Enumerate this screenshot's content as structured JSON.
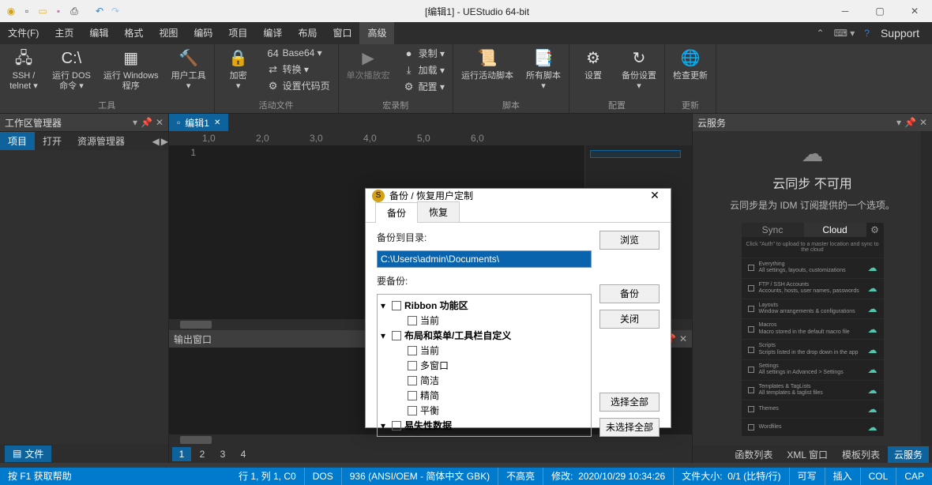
{
  "title": "[编辑1] - UEStudio 64-bit",
  "menubar": [
    "文件(F)",
    "主页",
    "编辑",
    "格式",
    "视图",
    "编码",
    "项目",
    "编译",
    "布局",
    "窗口",
    "高级"
  ],
  "menubar_active_index": 10,
  "menubar_right": {
    "support": "Support"
  },
  "ribbon": {
    "groups": [
      {
        "label": "工具",
        "buttons": [
          {
            "name": "ssh-telnet",
            "label": "SSH /\ntelnet ▾"
          },
          {
            "name": "run-dos",
            "label": "运行 DOS\n命令 ▾"
          },
          {
            "name": "run-windows",
            "label": "运行 Windows\n程序"
          },
          {
            "name": "user-tools",
            "label": "用户工具\n▾"
          }
        ]
      },
      {
        "label": "活动文件",
        "buttons": [
          {
            "name": "encrypt",
            "label": "加密\n▾"
          }
        ],
        "small": [
          {
            "name": "base64",
            "label": "Base64 ▾"
          },
          {
            "name": "convert",
            "label": "转换 ▾"
          },
          {
            "name": "set-codepage",
            "label": "设置代码页"
          }
        ]
      },
      {
        "label": "宏录制",
        "buttons": [
          {
            "name": "playback-once",
            "label": "单次播放宏",
            "disabled": true
          }
        ],
        "small": [
          {
            "name": "record",
            "label": "录制 ▾"
          },
          {
            "name": "load",
            "label": "加载 ▾"
          },
          {
            "name": "configure-macro",
            "label": "配置 ▾"
          }
        ]
      },
      {
        "label": "脚本",
        "buttons": [
          {
            "name": "run-active-script",
            "label": "运行活动脚本"
          },
          {
            "name": "all-scripts",
            "label": "所有脚本\n▾"
          }
        ]
      },
      {
        "label": "配置",
        "buttons": [
          {
            "name": "settings",
            "label": "设置"
          },
          {
            "name": "backup-settings",
            "label": "备份设置\n▾"
          }
        ]
      },
      {
        "label": "更新",
        "buttons": [
          {
            "name": "check-update",
            "label": "检查更新"
          }
        ]
      }
    ]
  },
  "left_panel": {
    "title": "工作区管理器",
    "tabs": [
      "项目",
      "打开",
      "资源管理器"
    ],
    "active_tab": 0,
    "bottom_tab": {
      "icon": "file-icon",
      "label": "文件"
    }
  },
  "editor": {
    "tab_label": "编辑1",
    "ruler_marks": [
      "1,0",
      "2,0",
      "3,0",
      "4,0",
      "5,0",
      "6,0"
    ],
    "line_number": "1"
  },
  "output": {
    "title": "输出窗口",
    "tabs": [
      "1",
      "2",
      "3",
      "4"
    ],
    "active_tab": 0
  },
  "right_panel": {
    "title": "云服务",
    "heading": "云同步 不可用",
    "sub": "云同步是为 IDM 订阅提供的一个选项。",
    "cp_tabs": [
      "Sync",
      "Cloud"
    ],
    "cp_msg": "Click \"Auth\" to upload to a master location and sync to the cloud",
    "cp_rows": [
      "Everything\nAll settings, layouts, customizations",
      "FTP / SSH Accounts\nAccounts, hosts, user names, passwords",
      "Layouts\nWindow arrangements & configurations",
      "Macros\nMacro stored in the default macro file",
      "Scripts\nScripts listed in the drop down in the app",
      "Settings\nAll settings in Advanced > Settings",
      "Templates & TagLists\nAll templates & taglist files",
      "Themes",
      "Wordfiles"
    ],
    "bottom_tabs": [
      "函数列表",
      "XML 窗口",
      "模板列表",
      "云服务"
    ],
    "bottom_active": 3
  },
  "dialog": {
    "title": "备份 / 恢复用户定制",
    "tabs": [
      "备份",
      "恢复"
    ],
    "active_tab": 0,
    "field_label": "备份到目录:",
    "field_value": "C:\\Users\\admin\\Documents\\",
    "browse_btn": "浏览",
    "second_label": "要备份:",
    "backup_btn": "备份",
    "close_btn": "关闭",
    "select_all_btn": "选择全部",
    "deselect_all_btn": "未选择全部",
    "tree": [
      {
        "label": "Ribbon 功能区",
        "level": 0
      },
      {
        "label": "当前",
        "level": 1
      },
      {
        "label": "布局和菜单/工具栏自定义",
        "level": 0
      },
      {
        "label": "当前",
        "level": 1
      },
      {
        "label": "多窗口",
        "level": 1
      },
      {
        "label": "简洁",
        "level": 1
      },
      {
        "label": "精简",
        "level": 1
      },
      {
        "label": "平衡",
        "level": 1
      },
      {
        "label": "易失性数据",
        "level": 0
      }
    ]
  },
  "statusbar": {
    "help": "按 F1 获取帮助",
    "pos": "行 1, 列 1, C0",
    "dos": "DOS",
    "enc": "936  (ANSI/OEM - 简体中文 GBK)",
    "highlight": "不高亮",
    "modified_label": "修改:",
    "modified_time": "2020/10/29 10:34:26",
    "size_label": "文件大小:",
    "size_val": "0/1 (比特/行)",
    "write": "可写",
    "insert": "插入",
    "col": "COL",
    "cap": "CAP"
  }
}
